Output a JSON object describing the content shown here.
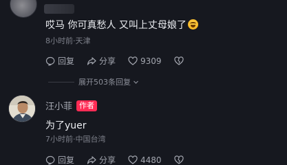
{
  "comments": [
    {
      "text": "哎马 你可真愁人 又叫上丈母娘了",
      "emoji": "rolling-laughing-emoji",
      "time": "8小时前·天津",
      "reply_label": "回复",
      "share_label": "分享",
      "likes": "9309",
      "replies_expand": "展开503条回复"
    },
    {
      "author": "汪小菲",
      "badge": "作者",
      "text": "为了yuer",
      "time": "7小时前·中国台湾",
      "reply_label": "回复",
      "share_label": "分享",
      "likes": "4480"
    }
  ],
  "colors": {
    "background": "#16181f",
    "badge": "#fe2c55",
    "meta": "#7d808a"
  }
}
